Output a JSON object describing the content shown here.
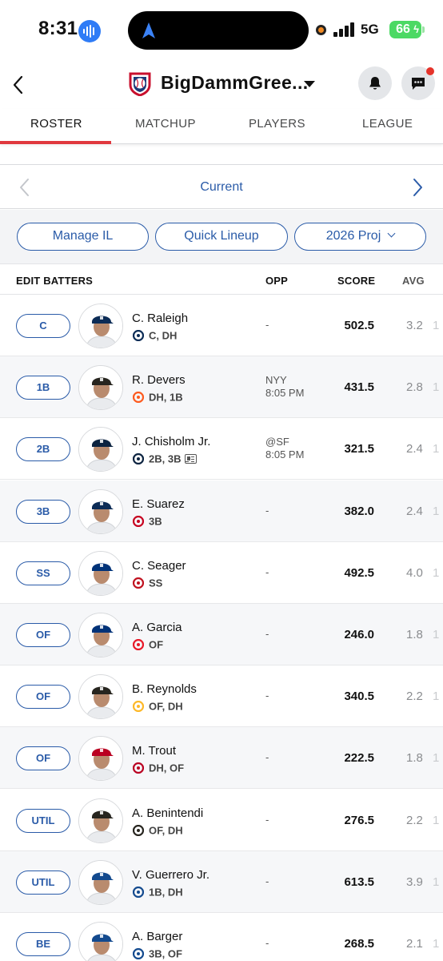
{
  "status_bar": {
    "time": "8:31",
    "network": "5G",
    "battery": "66",
    "icons": [
      "sound-wave-icon",
      "navigation-arrow-icon",
      "recording-dot-icon",
      "signal-bars-icon",
      "battery-icon"
    ]
  },
  "header": {
    "team_name": "BigDammGree...",
    "icons": [
      "back-chevron-icon",
      "team-logo-icon",
      "dropdown-caret-icon",
      "bell-icon",
      "chat-icon"
    ]
  },
  "tabs": [
    {
      "label": "ROSTER",
      "active": true
    },
    {
      "label": "MATCHUP",
      "active": false
    },
    {
      "label": "PLAYERS",
      "active": false
    },
    {
      "label": "LEAGUE",
      "active": false
    }
  ],
  "period": {
    "label": "Current"
  },
  "filters": {
    "manage_il": "Manage IL",
    "quick_lineup": "Quick Lineup",
    "projection": "2026 Proj"
  },
  "columns": {
    "edit": "EDIT BATTERS",
    "opp": "OPP",
    "score": "SCORE",
    "avg": "AVG"
  },
  "colors": {
    "accent": "#2a5ba8",
    "tab_underline": "#e0383e",
    "notification_dot": "#e5332a"
  },
  "players": [
    {
      "slot": "C",
      "name": "C. Raleigh",
      "positions": "C, DH",
      "team_icon": "mariners-logo-icon",
      "team_color": "#0c2c56",
      "opp": "-",
      "opp_time": "",
      "score": "502.5",
      "avg": "3.2",
      "extra": "1",
      "news": false,
      "cap": "#0c2c56"
    },
    {
      "slot": "1B",
      "name": "R. Devers",
      "positions": "DH, 1B",
      "team_icon": "giants-logo-icon",
      "team_color": "#fd5a1e",
      "opp": "NYY",
      "opp_time": "8:05 PM",
      "score": "431.5",
      "avg": "2.8",
      "extra": "1",
      "news": false,
      "cap": "#27251f"
    },
    {
      "slot": "2B",
      "name": "J. Chisholm Jr.",
      "positions": "2B, 3B",
      "team_icon": "yankees-logo-icon",
      "team_color": "#0c2340",
      "opp": "@SF",
      "opp_time": "8:05 PM",
      "score": "321.5",
      "avg": "2.4",
      "extra": "1",
      "news": true,
      "cap": "#0c2340"
    },
    {
      "slot": "3B",
      "name": "E. Suarez",
      "positions": "3B",
      "team_icon": "reds-logo-icon",
      "team_color": "#c6011f",
      "opp": "-",
      "opp_time": "",
      "score": "382.0",
      "avg": "2.4",
      "extra": "1",
      "news": false,
      "cap": "#0c2c56"
    },
    {
      "slot": "SS",
      "name": "C. Seager",
      "positions": "SS",
      "team_icon": "rangers-logo-icon",
      "team_color": "#c0111f",
      "opp": "-",
      "opp_time": "",
      "score": "492.5",
      "avg": "4.0",
      "extra": "1",
      "news": false,
      "cap": "#003278"
    },
    {
      "slot": "OF",
      "name": "A. Garcia",
      "positions": "OF",
      "team_icon": "phillies-logo-icon",
      "team_color": "#e81828",
      "opp": "-",
      "opp_time": "",
      "score": "246.0",
      "avg": "1.8",
      "extra": "1",
      "news": false,
      "cap": "#003278"
    },
    {
      "slot": "OF",
      "name": "B. Reynolds",
      "positions": "OF, DH",
      "team_icon": "pirates-logo-icon",
      "team_color": "#fdb827",
      "opp": "-",
      "opp_time": "",
      "score": "340.5",
      "avg": "2.2",
      "extra": "1",
      "news": false,
      "cap": "#27251f"
    },
    {
      "slot": "OF",
      "name": "M. Trout",
      "positions": "DH, OF",
      "team_icon": "angels-logo-icon",
      "team_color": "#ba0021",
      "opp": "-",
      "opp_time": "",
      "score": "222.5",
      "avg": "1.8",
      "extra": "1",
      "news": false,
      "cap": "#ba0021"
    },
    {
      "slot": "UTIL",
      "name": "A. Benintendi",
      "positions": "OF, DH",
      "team_icon": "white-sox-logo-icon",
      "team_color": "#27251f",
      "opp": "-",
      "opp_time": "",
      "score": "276.5",
      "avg": "2.2",
      "extra": "1",
      "news": false,
      "cap": "#27251f"
    },
    {
      "slot": "UTIL",
      "name": "V. Guerrero Jr.",
      "positions": "1B, DH",
      "team_icon": "blue-jays-logo-icon",
      "team_color": "#134a8e",
      "opp": "-",
      "opp_time": "",
      "score": "613.5",
      "avg": "3.9",
      "extra": "1",
      "news": false,
      "cap": "#134a8e"
    },
    {
      "slot": "BE",
      "name": "A. Barger",
      "positions": "3B, OF",
      "team_icon": "blue-jays-logo-icon",
      "team_color": "#134a8e",
      "opp": "-",
      "opp_time": "",
      "score": "268.5",
      "avg": "2.1",
      "extra": "1",
      "news": false,
      "cap": "#134a8e"
    }
  ]
}
